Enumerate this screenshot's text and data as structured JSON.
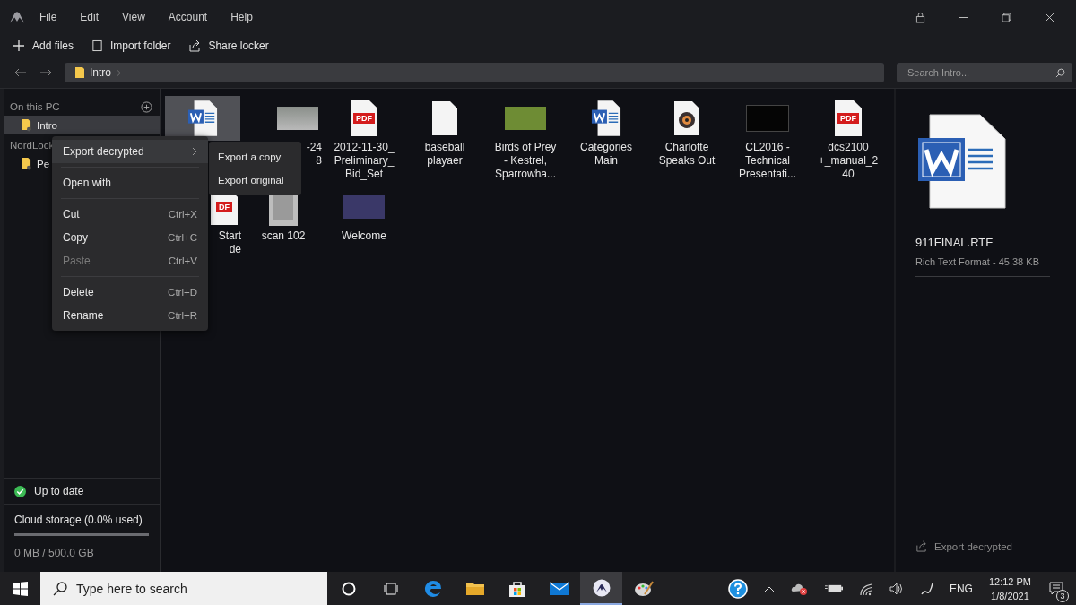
{
  "menu_bar": [
    "File",
    "Edit",
    "View",
    "Account",
    "Help"
  ],
  "toolbar": [
    {
      "kind": "add",
      "label": "Add files"
    },
    {
      "kind": "import",
      "label": "Import folder"
    },
    {
      "kind": "share",
      "label": "Share locker"
    }
  ],
  "breadcrumb": [
    "Intro"
  ],
  "search": {
    "placeholder": "Search Intro..."
  },
  "sidebar": {
    "sections": [
      {
        "title": "On this PC",
        "items": [
          {
            "label": "Intro",
            "selected": true
          }
        ]
      },
      {
        "title": "NordLock",
        "items": [
          {
            "label": "Pe",
            "selected": false
          }
        ]
      }
    ],
    "status": "Up to date",
    "storage": {
      "label": "Cloud storage (0.0% used)",
      "level": 0.0,
      "detail": "0 MB / 500.0 GB"
    }
  },
  "files": [
    {
      "kind": "word",
      "selected": true,
      "covered": false
    },
    {
      "kind": "photo",
      "label": "-24\n8",
      "selected": false,
      "covered": true
    },
    {
      "kind": "pdf",
      "badge": "PDF",
      "label": "2012-11-30_\nPreliminary_\nBid_Set",
      "selected": false,
      "covered": false
    },
    {
      "kind": "blank",
      "label": "baseball\nplayaer",
      "selected": false,
      "covered": false
    },
    {
      "kind": "photo",
      "label": "Birds of Prey\n- Kestrel,\nSparrowha...",
      "selected": false,
      "covered": false
    },
    {
      "kind": "word",
      "label": "Categories\nMain",
      "selected": false,
      "covered": false
    },
    {
      "kind": "music",
      "label": "Charlotte\nSpeaks Out",
      "selected": false,
      "covered": false
    },
    {
      "kind": "slide",
      "label": "CL2016 -\nTechnical\nPresentati...",
      "selected": false,
      "covered": false
    },
    {
      "kind": "pdf",
      "badge": "PDF",
      "label": "dcs2100\n+_manual_2\n40",
      "selected": false,
      "covered": false
    },
    {
      "kind": "pdf",
      "badge": "DF",
      "label": "Start\nde",
      "selected": false,
      "covered": true
    },
    {
      "kind": "scan",
      "label": "scan 102",
      "selected": false,
      "covered": false
    },
    {
      "kind": "screenshot",
      "label": "Welcome",
      "selected": false,
      "covered": false
    }
  ],
  "context_menu": [
    {
      "kind": "submenu",
      "label": "Export decrypted",
      "selected": true
    },
    {
      "kind": "separator"
    },
    {
      "kind": "item",
      "label": "Open with",
      "selected": false,
      "disabled": false
    },
    {
      "kind": "separator"
    },
    {
      "kind": "item",
      "label": "Cut",
      "shortcut": "Ctrl+X",
      "selected": false,
      "disabled": false
    },
    {
      "kind": "item",
      "label": "Copy",
      "shortcut": "Ctrl+C",
      "selected": false,
      "disabled": false
    },
    {
      "kind": "item",
      "label": "Paste",
      "shortcut": "Ctrl+V",
      "selected": false,
      "disabled": true
    },
    {
      "kind": "separator"
    },
    {
      "kind": "item",
      "label": "Delete",
      "shortcut": "Ctrl+D",
      "selected": false,
      "disabled": false
    },
    {
      "kind": "item",
      "label": "Rename",
      "shortcut": "Ctrl+R",
      "selected": false,
      "disabled": false
    }
  ],
  "submenu": [
    "Export a copy",
    "Export original"
  ],
  "details": {
    "name": "911FINAL.RTF",
    "info": "Rich Text Format - 45.38 KB",
    "action": "Export decrypted"
  },
  "taskbar": {
    "search_placeholder": "Type here to search",
    "apps": [
      {
        "kind": "cortana",
        "active": false
      },
      {
        "kind": "taskview",
        "active": false
      },
      {
        "kind": "edge",
        "active": false
      },
      {
        "kind": "explorer",
        "active": false
      },
      {
        "kind": "store",
        "active": false
      },
      {
        "kind": "mail",
        "active": false
      },
      {
        "kind": "nordlocker",
        "active": true
      },
      {
        "kind": "paint",
        "active": false
      }
    ],
    "language": "ENG",
    "time": "12:12 PM",
    "date": "1/8/2021",
    "notifications": "3"
  }
}
